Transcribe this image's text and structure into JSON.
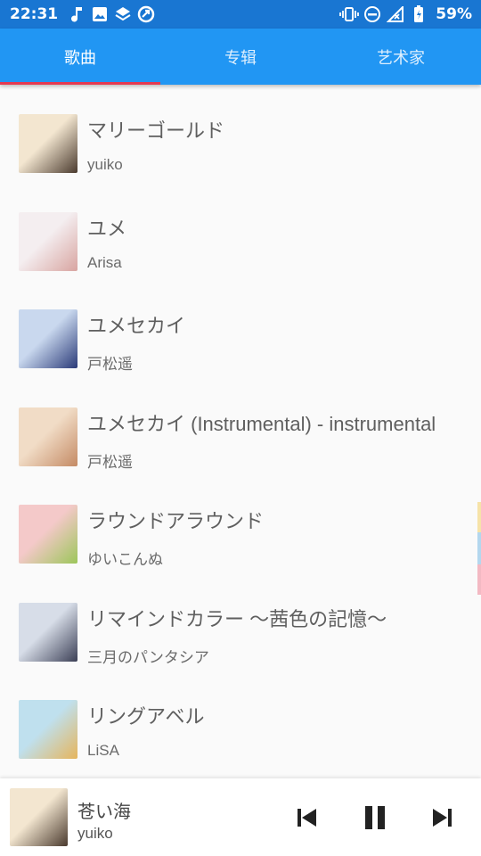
{
  "status": {
    "time": "22:31",
    "battery": "59%"
  },
  "tabs": [
    {
      "label": "歌曲",
      "active": true
    },
    {
      "label": "专辑",
      "active": false
    },
    {
      "label": "艺术家",
      "active": false
    }
  ],
  "songs": [
    {
      "title": "マリーゴールド",
      "artist": "yuiko",
      "art": [
        "#f3e6d0",
        "#4a3a2e"
      ]
    },
    {
      "title": "ユメ",
      "artist": "Arisa",
      "art": [
        "#f4eef0",
        "#d8a4a0"
      ]
    },
    {
      "title": "ユメセカイ",
      "artist": "戸松遥",
      "art": [
        "#c9d8ee",
        "#2a3a78"
      ]
    },
    {
      "title": "ユメセカイ (Instrumental) - instrumental",
      "artist": "戸松遥",
      "art": [
        "#f1dcc6",
        "#c48a64"
      ]
    },
    {
      "title": "ラウンドアラウンド",
      "artist": "ゆいこんぬ",
      "art": [
        "#f4c9c9",
        "#9cc65a"
      ]
    },
    {
      "title": "リマインドカラー 〜茜色の記憶〜",
      "artist": "三月のパンタシア",
      "art": [
        "#d7dde8",
        "#3b3f55"
      ]
    },
    {
      "title": "リングアベル",
      "artist": "LiSA",
      "art": [
        "#bfe0ee",
        "#e6b55c"
      ]
    }
  ],
  "player": {
    "title": "苍い海",
    "artist": "yuiko",
    "art": [
      "#f3e6d0",
      "#4a3a2e"
    ]
  },
  "colors": {
    "statusbar": "#1976d2",
    "tabbar": "#2196f3",
    "indicator": "#e53950"
  }
}
